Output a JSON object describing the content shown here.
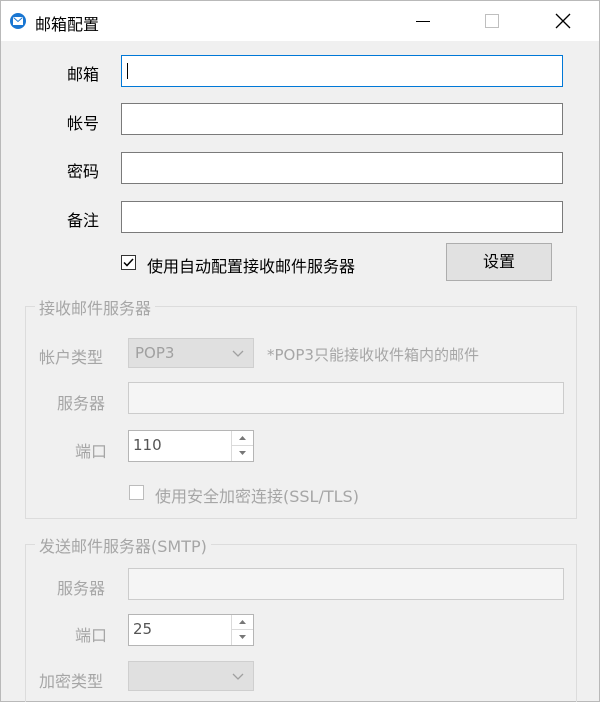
{
  "window": {
    "title": "邮箱配置"
  },
  "form": {
    "email_label": "邮箱",
    "email_value": "",
    "account_label": "帐号",
    "account_value": "",
    "password_label": "密码",
    "password_value": "",
    "note_label": "备注",
    "note_value": "",
    "auto_config_label": "使用自动配置接收邮件服务器",
    "auto_config_checked": true,
    "settings_button": "设置"
  },
  "incoming": {
    "group_title": "接收邮件服务器",
    "account_type_label": "帐户类型",
    "account_type_value": "POP3",
    "account_type_hint": "*POP3只能接收收件箱内的邮件",
    "server_label": "服务器",
    "server_value": "",
    "port_label": "端口",
    "port_value": "110",
    "ssl_label": "使用安全加密连接(SSL/TLS)",
    "ssl_checked": false
  },
  "outgoing": {
    "group_title": "发送邮件服务器(SMTP)",
    "server_label": "服务器",
    "server_value": "",
    "port_label": "端口",
    "port_value": "25",
    "encryption_label": "加密类型",
    "encryption_value": ""
  },
  "icons": {
    "app": "mail-icon",
    "minimize": "minimize-icon",
    "maximize": "maximize-icon",
    "close": "close-icon",
    "check": "checkmark-icon",
    "dropdown": "chevron-down-icon",
    "spin_up": "spin-up-icon",
    "spin_down": "spin-down-icon"
  },
  "colors": {
    "accent": "#0078d7",
    "app_icon": "#1976d2",
    "disabled_text": "#a6a6a6",
    "window_bg": "#f0f0f0"
  }
}
